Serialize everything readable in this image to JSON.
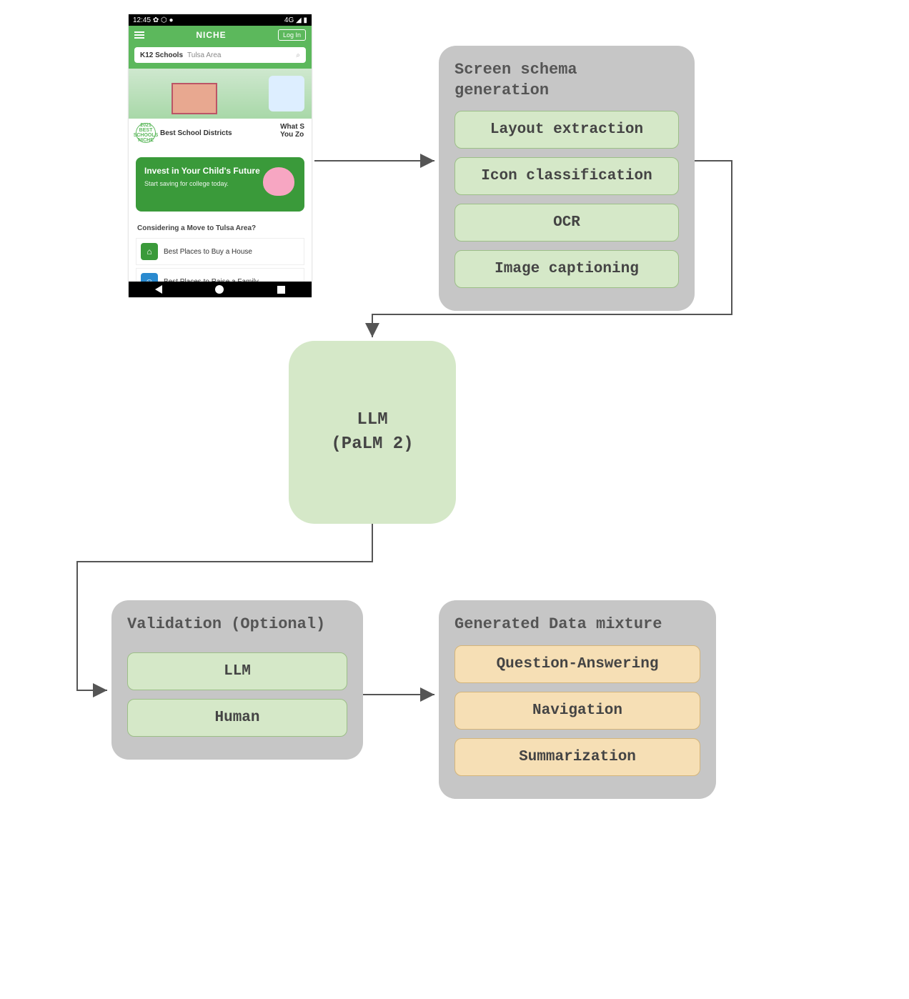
{
  "phone": {
    "statusbar_time": "12:45",
    "statusbar_icons": "✿ ⬡ ●",
    "statusbar_right": "4G ◢ ▮",
    "brand": "NICHE",
    "login": "Log In",
    "search_category": "K12 Schools",
    "search_area": "Tulsa Area",
    "card1": "Best School Districts",
    "card2": "What S\nYou Zo",
    "badge_text": "2021 BEST SCHOOLS NICHE",
    "promo_title": "Invest in Your Child's Future",
    "promo_sub": "Start saving for college today.",
    "considering": "Considering a Move to Tulsa Area?",
    "item1": "Best Places to Buy a House",
    "item2": "Best Places to Raise a Family"
  },
  "schema_box": {
    "title": "Screen schema generation",
    "items": [
      "Layout extraction",
      "Icon classification",
      "OCR",
      "Image captioning"
    ]
  },
  "llm_box": {
    "line1": "LLM",
    "line2": "(PaLM 2)"
  },
  "validation_box": {
    "title": "Validation (Optional)",
    "items": [
      "LLM",
      "Human"
    ]
  },
  "generated_box": {
    "title": "Generated Data mixture",
    "items": [
      "Question-Answering",
      "Navigation",
      "Summarization"
    ]
  },
  "diagram": {
    "nodes": [
      "Mobile screenshot",
      "Screen schema generation",
      "LLM (PaLM 2)",
      "Validation (Optional)",
      "Generated Data mixture"
    ],
    "edges": [
      [
        "Mobile screenshot",
        "Screen schema generation"
      ],
      [
        "Screen schema generation",
        "LLM (PaLM 2)"
      ],
      [
        "LLM (PaLM 2)",
        "Validation (Optional)"
      ],
      [
        "Validation (Optional)",
        "Generated Data mixture"
      ]
    ]
  }
}
